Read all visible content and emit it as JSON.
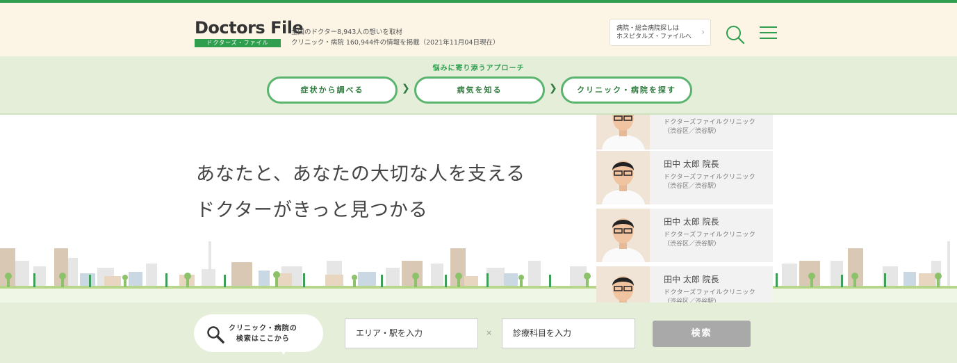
{
  "brand": {
    "logo_text": "Doctors File",
    "logo_sub": "ドクターズ・ファイル",
    "tagline_line1": "全国のドクター8,943人の想いを取材",
    "tagline_line2": "クリニック・病院 160,944件の情報を掲載（2021年11月04日現在）"
  },
  "header": {
    "hospital_link_line1": "病院・総合病院探しは",
    "hospital_link_line2": "ホスピタルズ・ファイルへ",
    "hospital_link_chevron": "›"
  },
  "approach": {
    "title": "悩みに寄り添うアプローチ",
    "arrow": "❯",
    "steps": [
      {
        "label": "症状から調べる"
      },
      {
        "label": "病気を知る"
      },
      {
        "label": "クリニック・病院を探す"
      }
    ]
  },
  "hero": {
    "catch_line1": "あなたと、あなたの大切な人を支える",
    "catch_line2": "ドクターがきっと見つかる"
  },
  "doctors": [
    {
      "name": "",
      "clinic": "ドクターズファイルクリニック",
      "area": "（渋谷区／渋谷駅）"
    },
    {
      "name": "田中 太郎 院長",
      "clinic": "ドクターズファイルクリニック",
      "area": "（渋谷区／渋谷駅）"
    },
    {
      "name": "田中 太郎 院長",
      "clinic": "ドクターズファイルクリニック",
      "area": "（渋谷区／渋谷駅）"
    },
    {
      "name": "田中 太郎 院長",
      "clinic": "ドクターズファイルクリニック",
      "area": "（渋谷区／渋谷駅）"
    }
  ],
  "search": {
    "bubble_line1": "クリニック・病院の",
    "bubble_line2": "検索はここから",
    "area_placeholder": "エリア・駅を入力",
    "separator": "×",
    "dept_placeholder": "診療科目を入力",
    "submit_label": "検索"
  },
  "colors": {
    "brand_green": "#2f9e4f",
    "header_bg": "#fcf5e6",
    "section_bg": "#e4eed8",
    "submit_disabled": "#a9a9a9"
  }
}
